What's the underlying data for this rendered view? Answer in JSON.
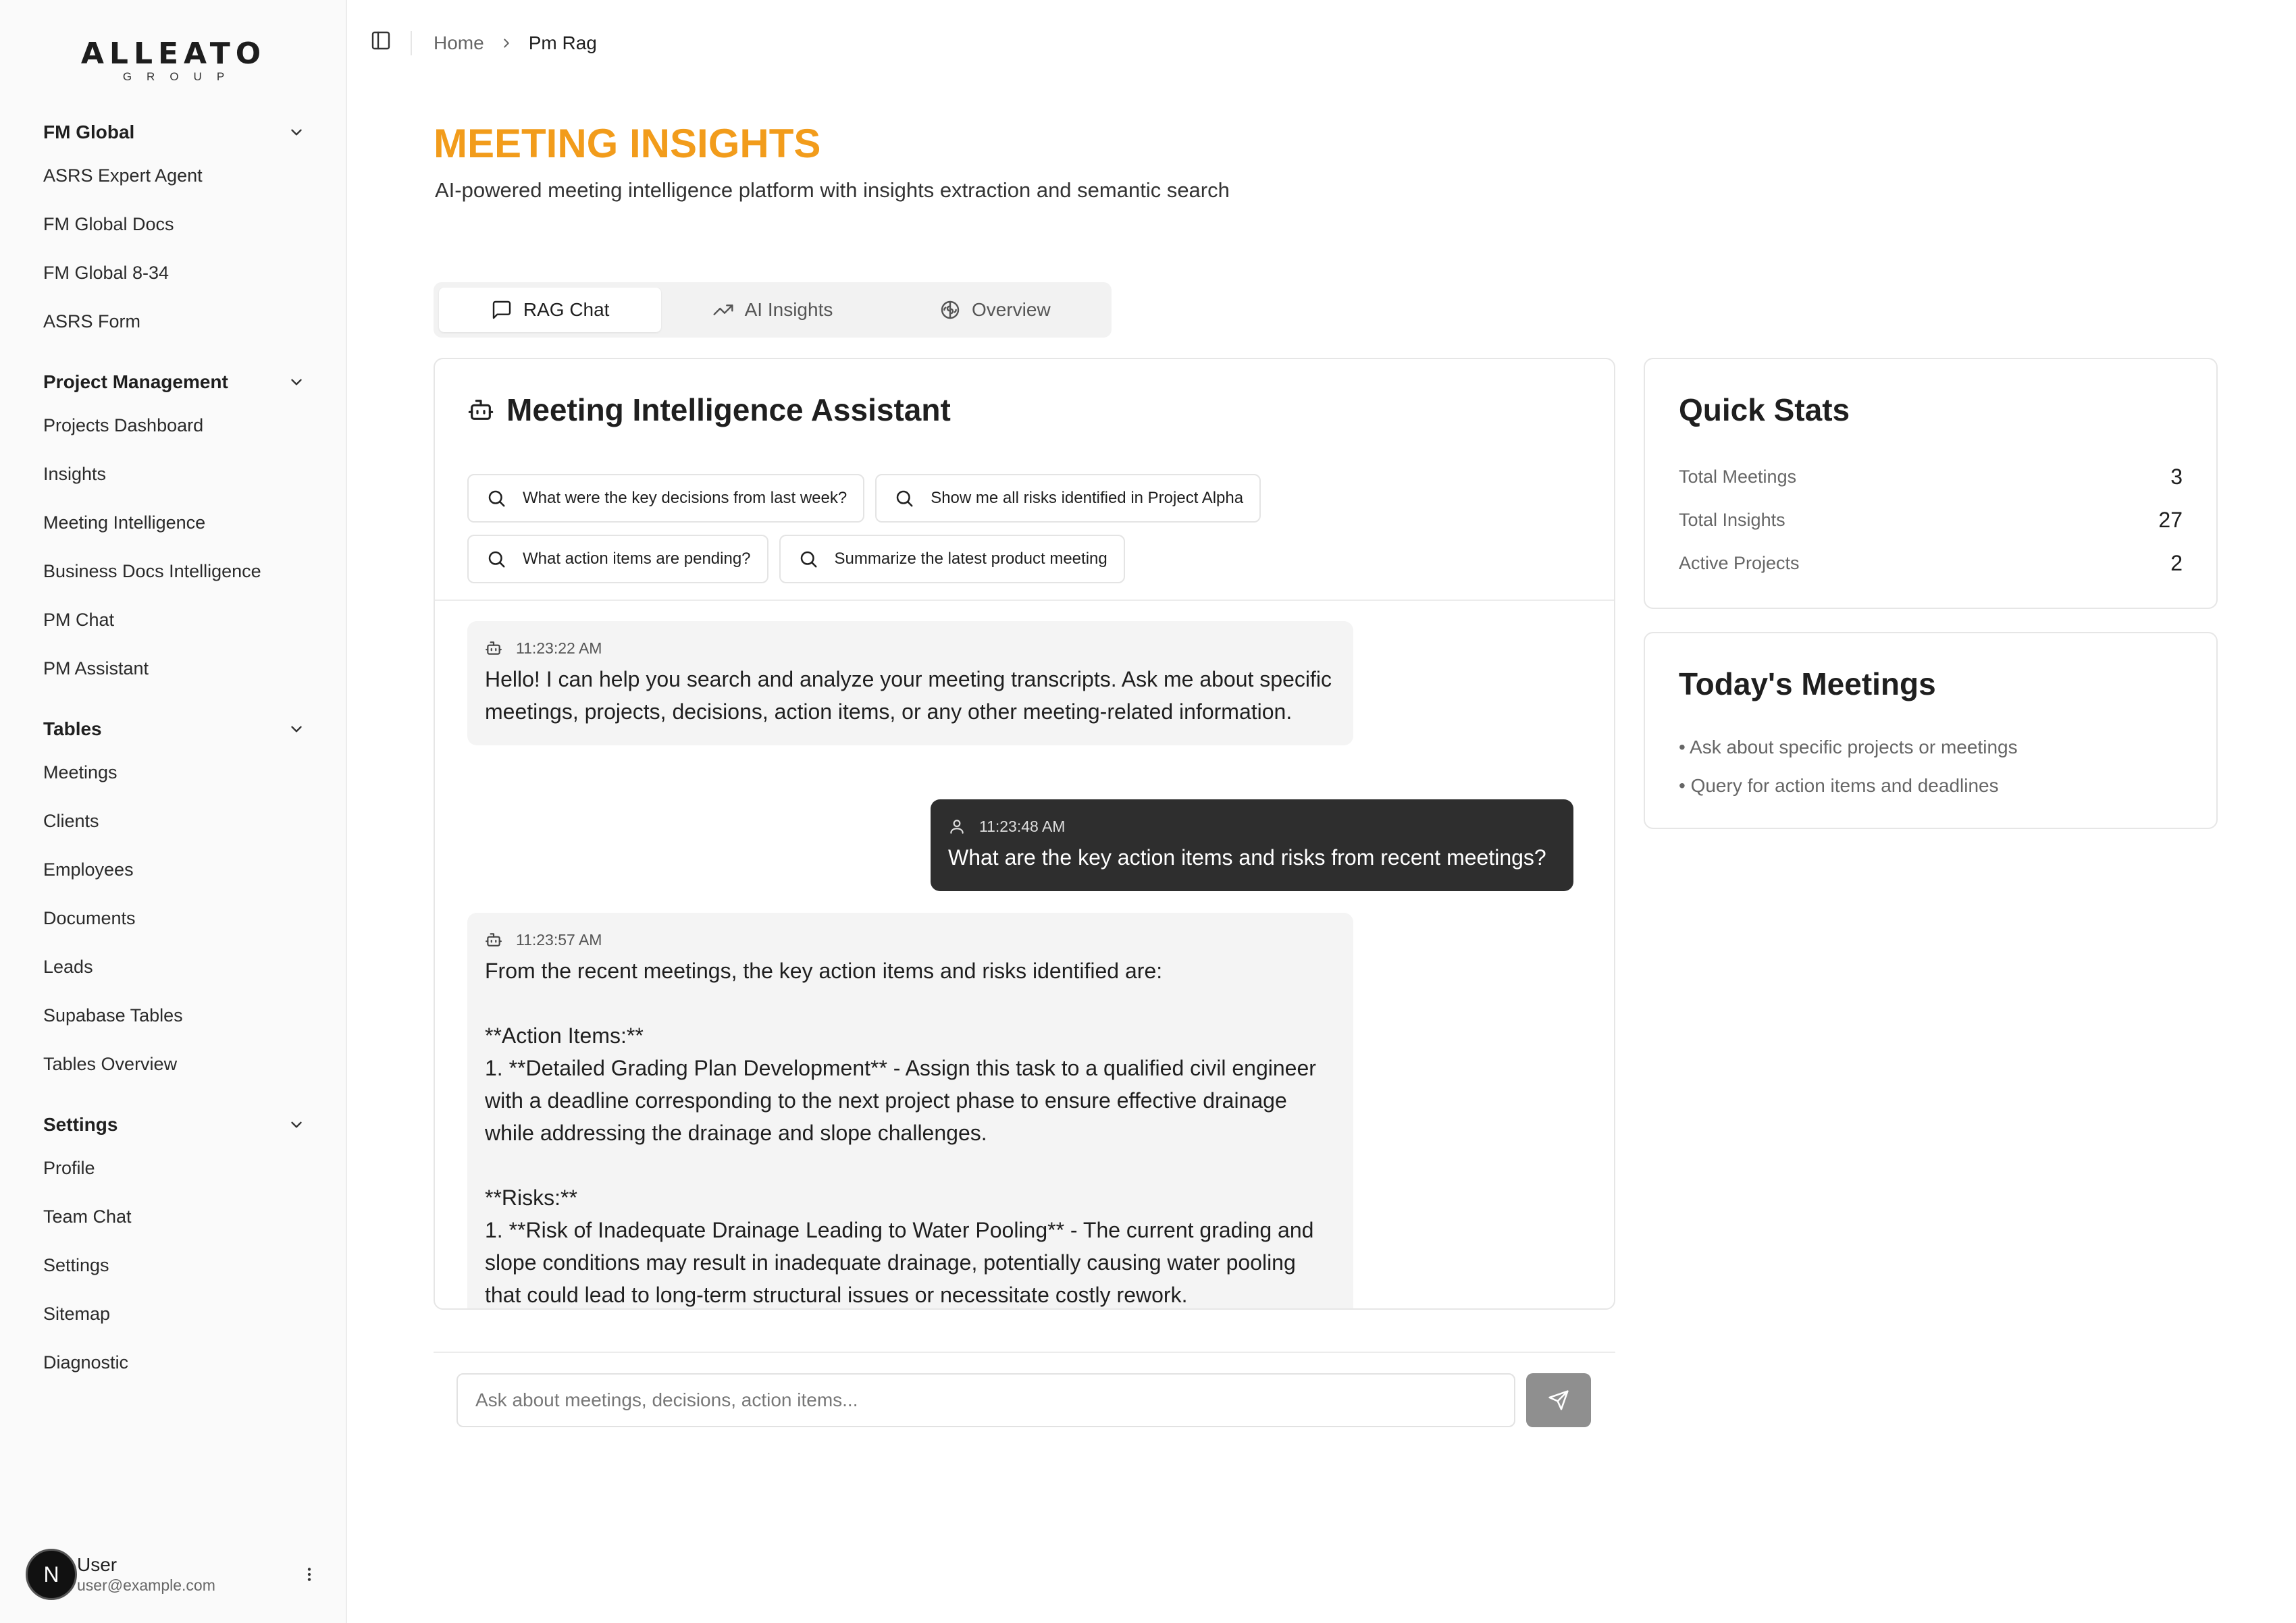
{
  "brand": {
    "name": "ALLEATO",
    "sub": "GROUP"
  },
  "sidebar": {
    "groups": [
      {
        "title": "FM Global",
        "items": [
          "ASRS Expert Agent",
          "FM Global Docs",
          "FM Global 8-34",
          "ASRS Form"
        ]
      },
      {
        "title": "Project Management",
        "items": [
          "Projects Dashboard",
          "Insights",
          "Meeting Intelligence",
          "Business Docs Intelligence",
          "PM Chat",
          "PM Assistant"
        ]
      },
      {
        "title": "Tables",
        "items": [
          "Meetings",
          "Clients",
          "Employees",
          "Documents",
          "Leads",
          "Supabase Tables",
          "Tables Overview"
        ]
      },
      {
        "title": "Settings",
        "items": [
          "Profile",
          "Team Chat",
          "Settings",
          "Sitemap",
          "Diagnostic"
        ]
      }
    ]
  },
  "user": {
    "initial": "N",
    "name": "User",
    "email": "user@example.com"
  },
  "breadcrumb": {
    "home": "Home",
    "current": "Pm Rag"
  },
  "page": {
    "title": "MEETING INSIGHTS",
    "subtitle": "AI-powered meeting intelligence platform with insights extraction and semantic search"
  },
  "tabs": [
    {
      "label": "RAG Chat",
      "icon": "message-square-icon",
      "active": true
    },
    {
      "label": "AI Insights",
      "icon": "trending-up-icon",
      "active": false
    },
    {
      "label": "Overview",
      "icon": "brain-icon",
      "active": false
    }
  ],
  "chat": {
    "title": "Meeting Intelligence Assistant",
    "suggestions": [
      "What were the key decisions from last week?",
      "Show me all risks identified in Project Alpha",
      "What action items are pending?",
      "Summarize the latest product meeting"
    ],
    "messages": [
      {
        "role": "bot",
        "time": "11:23:22 AM",
        "text": "Hello! I can help you search and analyze your meeting transcripts. Ask me about specific meetings, projects, decisions, action items, or any other meeting-related information."
      },
      {
        "role": "user",
        "time": "11:23:48 AM",
        "text": "What are the key action items and risks from recent meetings?"
      },
      {
        "role": "bot",
        "time": "11:23:57 AM",
        "text": "From the recent meetings, the key action items and risks identified are:\n\n**Action Items:**\n1. **Detailed Grading Plan Development** - Assign this task to a qualified civil engineer with a deadline corresponding to the next project phase to ensure effective drainage while addressing the drainage and slope challenges.\n\n**Risks:**\n1. **Risk of Inadequate Drainage Leading to Water Pooling** - The current grading and slope conditions may result in inadequate drainage, potentially causing water pooling that could lead to long-term structural issues or necessitate costly rework."
      }
    ],
    "input_placeholder": "Ask about meetings, decisions, action items..."
  },
  "quick_stats": {
    "title": "Quick Stats",
    "rows": [
      {
        "label": "Total Meetings",
        "value": "3"
      },
      {
        "label": "Total Insights",
        "value": "27"
      },
      {
        "label": "Active Projects",
        "value": "2"
      }
    ]
  },
  "todays_meetings": {
    "title": "Today's Meetings",
    "tips": [
      "• Ask about specific projects or meetings",
      "• Query for action items and deadlines"
    ]
  },
  "colors": {
    "accent": "#f29c1b",
    "user_bubble": "#2e2e2e",
    "bot_bubble": "#f4f4f4",
    "send_button": "#8f8f8f"
  }
}
